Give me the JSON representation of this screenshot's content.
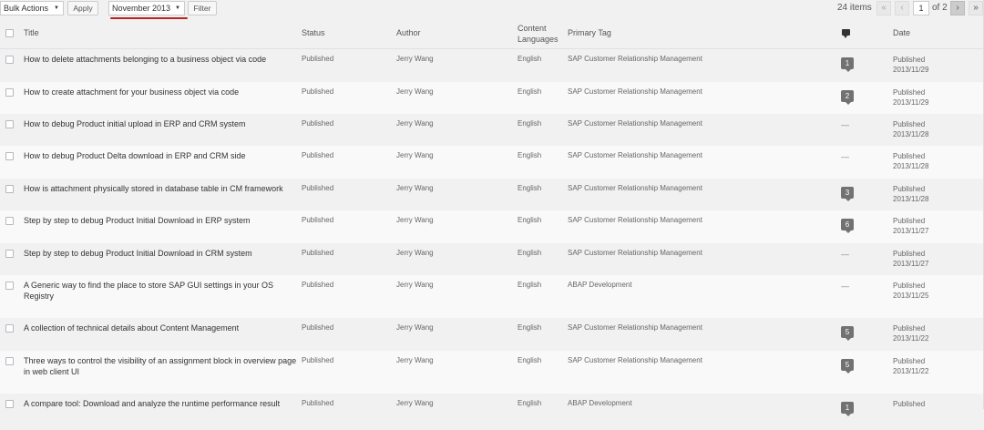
{
  "toolbar": {
    "bulk_actions": "Bulk Actions",
    "apply": "Apply",
    "month_filter": "November 2013",
    "filter": "Filter"
  },
  "pagination": {
    "items_count": "24 items",
    "first": "«",
    "prev": "‹",
    "current_page": "1",
    "of_total": "of 2",
    "next": "›",
    "last": "»"
  },
  "columns": {
    "title": "Title",
    "status": "Status",
    "author": "Author",
    "content_languages": "Content Languages",
    "primary_tag": "Primary Tag",
    "comments_icon": "comment-icon",
    "date": "Date"
  },
  "rows": [
    {
      "title": "How to delete attachments belonging to a business object via code",
      "status": "Published",
      "author": "Jerry Wang",
      "lang": "English",
      "tag": "SAP Customer Relationship Management",
      "comments": "1",
      "date_status": "Published",
      "date": "2013/11/29"
    },
    {
      "title": "How to create attachment for your business object via code",
      "status": "Published",
      "author": "Jerry Wang",
      "lang": "English",
      "tag": "SAP Customer Relationship Management",
      "comments": "2",
      "date_status": "Published",
      "date": "2013/11/29"
    },
    {
      "title": "How to debug Product initial upload in ERP and CRM system",
      "status": "Published",
      "author": "Jerry Wang",
      "lang": "English",
      "tag": "SAP Customer Relationship Management",
      "comments": "—",
      "date_status": "Published",
      "date": "2013/11/28"
    },
    {
      "title": "How to debug Product Delta download in ERP and CRM side",
      "status": "Published",
      "author": "Jerry Wang",
      "lang": "English",
      "tag": "SAP Customer Relationship Management",
      "comments": "—",
      "date_status": "Published",
      "date": "2013/11/28"
    },
    {
      "title": "How is attachment physically stored in database table in CM framework",
      "status": "Published",
      "author": "Jerry Wang",
      "lang": "English",
      "tag": "SAP Customer Relationship Management",
      "comments": "3",
      "date_status": "Published",
      "date": "2013/11/28"
    },
    {
      "title": "Step by step to debug Product Initial Download in ERP system",
      "status": "Published",
      "author": "Jerry Wang",
      "lang": "English",
      "tag": "SAP Customer Relationship Management",
      "comments": "6",
      "date_status": "Published",
      "date": "2013/11/27"
    },
    {
      "title": "Step by step to debug Product Initial Download in CRM system",
      "status": "Published",
      "author": "Jerry Wang",
      "lang": "English",
      "tag": "SAP Customer Relationship Management",
      "comments": "—",
      "date_status": "Published",
      "date": "2013/11/27"
    },
    {
      "title": "A Generic way to find the place to store SAP GUI settings in your OS Registry",
      "status": "Published",
      "author": "Jerry Wang",
      "lang": "English",
      "tag": "ABAP Development",
      "comments": "—",
      "date_status": "Published",
      "date": "2013/11/25"
    },
    {
      "title": "A collection of technical details about Content Management",
      "status": "Published",
      "author": "Jerry Wang",
      "lang": "English",
      "tag": "SAP Customer Relationship Management",
      "comments": "5",
      "date_status": "Published",
      "date": "2013/11/22"
    },
    {
      "title": "Three ways to control the visibility of an assignment block in overview page in web client UI",
      "status": "Published",
      "author": "Jerry Wang",
      "lang": "English",
      "tag": "SAP Customer Relationship Management",
      "comments": "5",
      "date_status": "Published",
      "date": "2013/11/22"
    },
    {
      "title": "A compare tool: Download and analyze the runtime performance result",
      "status": "Published",
      "author": "Jerry Wang",
      "lang": "English",
      "tag": "ABAP Development",
      "comments": "1",
      "date_status": "Published",
      "date": ""
    }
  ]
}
